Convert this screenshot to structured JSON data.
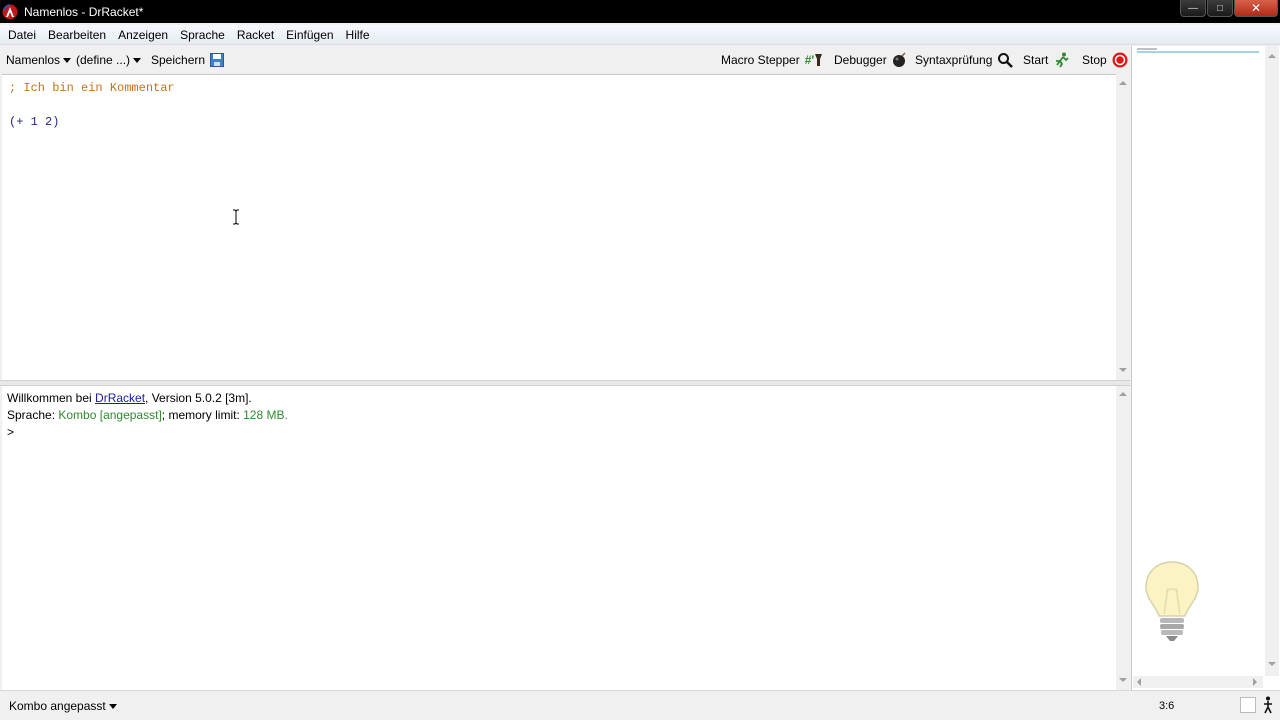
{
  "window": {
    "title": "Namenlos - DrRacket*",
    "controls": {
      "minimize": "—",
      "maximize": "□",
      "close": "✕"
    }
  },
  "menu": [
    "Datei",
    "Bearbeiten",
    "Anzeigen",
    "Sprache",
    "Racket",
    "Einfügen",
    "Hilfe"
  ],
  "toolbar": {
    "file_menu": "Namenlos",
    "define_menu": "(define ...)",
    "save": "Speichern",
    "macro_stepper": "Macro Stepper",
    "macro_stepper_glyph": "#'",
    "debugger": "Debugger",
    "syntax_check": "Syntaxprüfung",
    "run": "Start",
    "stop": "Stop"
  },
  "definitions": {
    "line1": "; Ich bin ein Kommentar",
    "line2": "(+ 1 2)"
  },
  "interactions": {
    "welcome_prefix": "Willkommen bei ",
    "welcome_link": "DrRacket",
    "welcome_suffix": ", Version 5.0.2 [3m].",
    "language_prefix": "Sprache: ",
    "language_value": "Kombo [angepasst]",
    "memory_prefix": "; memory limit: ",
    "memory_value": "128 MB",
    "period": ".",
    "prompt": ">"
  },
  "status": {
    "language": "Kombo angepasst",
    "position": "3:6"
  },
  "colors": {
    "comment": "#c2741f",
    "code": "#262680",
    "link": "#1a1aa6",
    "language_green": "#2f8a2f",
    "stop_red": "#e01818"
  }
}
